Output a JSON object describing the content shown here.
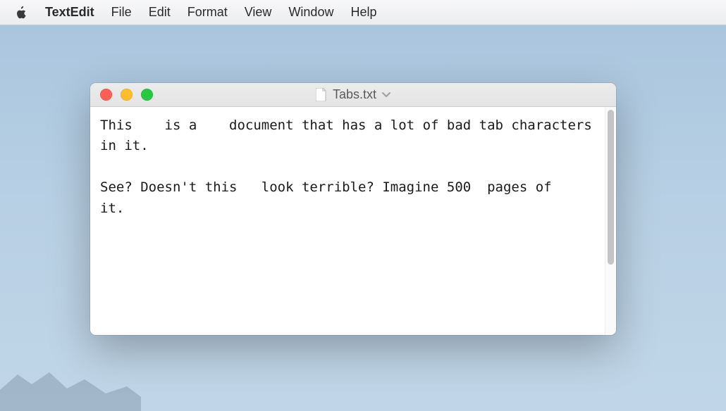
{
  "menubar": {
    "app_name": "TextEdit",
    "items": [
      "File",
      "Edit",
      "Format",
      "View",
      "Window",
      "Help"
    ]
  },
  "window": {
    "title": "Tabs.txt",
    "document_text": "This\tis a\tdocument that has a lot of bad tab characters in it.\n\nSee? Doesn't this\tlook terrible? Imagine 500\tpages of\tit."
  }
}
